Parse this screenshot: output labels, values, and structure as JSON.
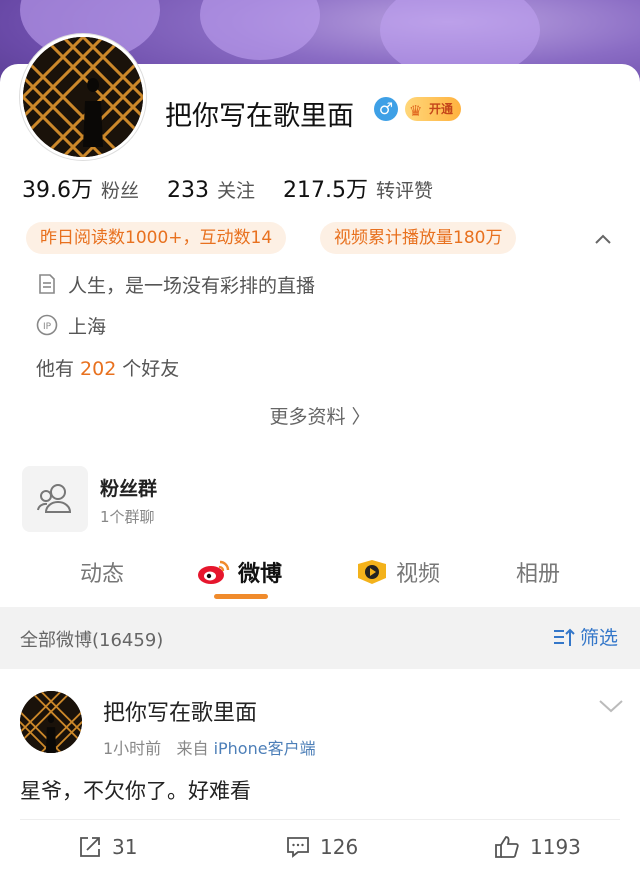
{
  "profile": {
    "username": "把你写在歌里面",
    "gender_icon": "male-icon",
    "vip_badge": "开通",
    "stats": [
      {
        "value": "39.6万",
        "label": "粉丝"
      },
      {
        "value": "233",
        "label": "关注"
      },
      {
        "value": "217.5万",
        "label": "转评赞"
      }
    ],
    "pills": [
      "昨日阅读数1000+，互动数14",
      "视频累计播放量180万"
    ],
    "bio": "人生，是一场没有彩排的直播",
    "location": "上海",
    "friends": {
      "prefix": "他有",
      "count": "202",
      "suffix": "个好友"
    },
    "more_info": "更多资料 〉"
  },
  "fan_group": {
    "title": "粉丝群",
    "subtitle": "1个群聊"
  },
  "tabs": [
    {
      "label": "动态"
    },
    {
      "label": "微博"
    },
    {
      "label": "视频"
    },
    {
      "label": "相册"
    }
  ],
  "filter": {
    "title": "全部微博(16459)",
    "button": "筛选"
  },
  "post": {
    "author": "把你写在歌里面",
    "time": "1小时前",
    "source_prefix": "来自",
    "source": "iPhone客户端",
    "text": "星爷，不欠你了。好难看",
    "reposts": "31",
    "comments": "126",
    "likes": "1193"
  },
  "colors": {
    "accent": "#e8711f",
    "link": "#3477c9",
    "pill_bg": "#fdf0e4"
  }
}
